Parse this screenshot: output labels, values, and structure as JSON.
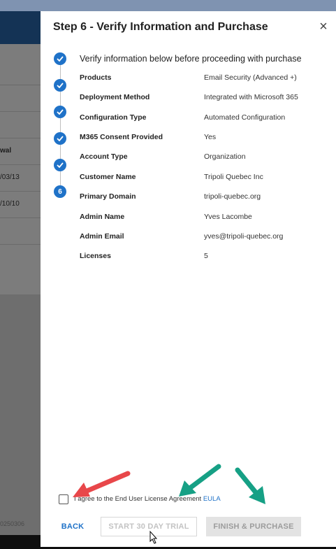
{
  "background": {
    "column_header": "wal",
    "rows": [
      "/03/13",
      "/10/10"
    ],
    "footer_code": "0250306"
  },
  "drawer": {
    "title": "Step 6 - Verify Information and Purchase",
    "close_icon": "×",
    "stepper": {
      "steps": [
        "check",
        "check",
        "check",
        "check",
        "check",
        "6"
      ],
      "active_step": "6"
    },
    "heading": "Verify information below before proceeding with purchase",
    "fields": [
      {
        "label": "Products",
        "value": "Email Security (Advanced +)"
      },
      {
        "label": "Deployment Method",
        "value": "Integrated with Microsoft 365"
      },
      {
        "label": "Configuration Type",
        "value": "Automated Configuration"
      },
      {
        "label": "M365 Consent Provided",
        "value": "Yes"
      },
      {
        "label": "Account Type",
        "value": "Organization"
      },
      {
        "label": "Customer Name",
        "value": "Tripoli Quebec Inc"
      },
      {
        "label": "Primary Domain",
        "value": "tripoli-quebec.org"
      },
      {
        "label": "Admin Name",
        "value": "Yves Lacombe"
      },
      {
        "label": "Admin Email",
        "value": "yves@tripoli-quebec.org"
      },
      {
        "label": "Licenses",
        "value": "5"
      }
    ],
    "eula": {
      "text": "I agree to the End User License Agreement",
      "link": "EULA",
      "checked": false
    },
    "buttons": {
      "back": "BACK",
      "trial": "START 30 DAY TRIAL",
      "finish": "FINISH & PURCHASE"
    }
  },
  "colors": {
    "accent": "#1f72c8",
    "header_dark": "#143355",
    "arrow_red": "#e8474a",
    "arrow_green": "#16a085"
  }
}
